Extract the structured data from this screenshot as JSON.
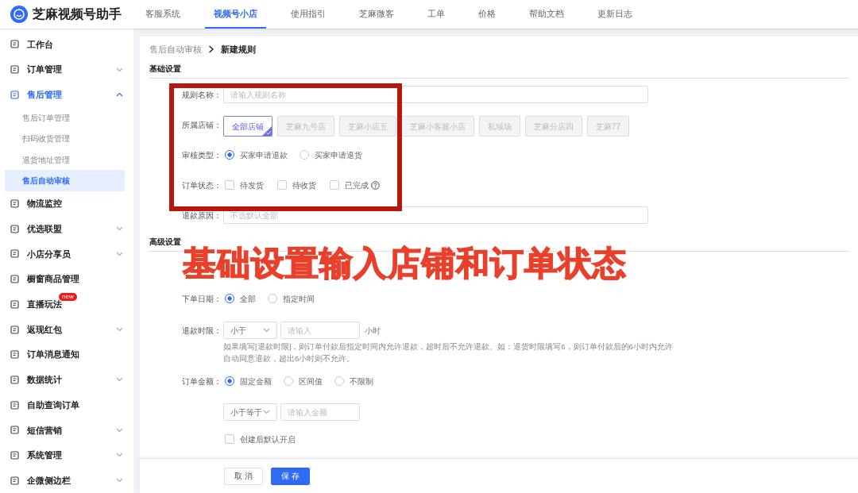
{
  "app": {
    "title": "芝麻视频号助手"
  },
  "top_nav": [
    {
      "label": "客服系统",
      "selected": false
    },
    {
      "label": "视频号小店",
      "selected": true
    },
    {
      "label": "使用指引",
      "selected": false
    },
    {
      "label": "芝麻微客",
      "selected": false
    },
    {
      "label": "工单",
      "selected": false
    },
    {
      "label": "价格",
      "selected": false
    },
    {
      "label": "帮助文档",
      "selected": false
    },
    {
      "label": "更新日志",
      "selected": false
    }
  ],
  "sidebar": {
    "items": [
      {
        "label": "工作台",
        "selected": false
      },
      {
        "label": "订单管理",
        "selected": false,
        "expanded": false
      },
      {
        "label": "售后管理",
        "selected": true,
        "expanded": true,
        "children": [
          {
            "label": "售后订单管理",
            "selected": false
          },
          {
            "label": "扫码收货管理",
            "selected": false
          },
          {
            "label": "退货地址管理",
            "selected": false
          },
          {
            "label": "售后自动审核",
            "selected": true
          }
        ]
      },
      {
        "label": "物流监控",
        "selected": false
      },
      {
        "label": "优选联盟",
        "selected": false,
        "expanded": false
      },
      {
        "label": "小店分享员",
        "selected": false,
        "expanded": false
      },
      {
        "label": "橱窗商品管理",
        "selected": false
      },
      {
        "label": "直播玩法",
        "selected": false,
        "badge": "new"
      },
      {
        "label": "返现红包",
        "selected": false,
        "expanded": false
      },
      {
        "label": "订单消息通知",
        "selected": false
      },
      {
        "label": "数据统计",
        "selected": false,
        "expanded": false
      },
      {
        "label": "自助查询订单",
        "selected": false
      },
      {
        "label": "短信营销",
        "selected": false,
        "expanded": false
      },
      {
        "label": "系统管理",
        "selected": false,
        "expanded": false
      },
      {
        "label": "企微侧边栏",
        "selected": false,
        "expanded": false
      }
    ]
  },
  "breadcrumb": [
    {
      "label": "售后自动审核"
    },
    {
      "label": "新建规则"
    }
  ],
  "basic_settings": {
    "title": "基础设置",
    "fields": [
      {
        "kind": "input",
        "label": "规则名称：",
        "placeholder": "请输入规则名称"
      },
      {
        "kind": "shops",
        "label": "所属店铺：",
        "options": [
          {
            "label": "全部店铺",
            "selected": true
          },
          {
            "label": "芝麻九号店",
            "selected": false
          },
          {
            "label": "芝麻小店五",
            "selected": false
          },
          {
            "label": "芝麻小客服小店",
            "selected": false
          },
          {
            "label": "私域场",
            "selected": false
          },
          {
            "label": "芝麻分店四",
            "selected": false
          },
          {
            "label": "芝麻77",
            "selected": false
          }
        ]
      },
      {
        "kind": "radio",
        "label": "审核类型：",
        "options": [
          {
            "label": "买家申请退款",
            "selected": true
          },
          {
            "label": "买家申请退货",
            "selected": false
          }
        ]
      },
      {
        "kind": "checkbox",
        "label": "订单状态：",
        "options": [
          {
            "label": "待发货",
            "checked": false
          },
          {
            "label": "待收货",
            "checked": false
          },
          {
            "label": "已完成",
            "checked": false,
            "help": true
          }
        ]
      },
      {
        "kind": "input",
        "label": "退款原因：",
        "placeholder": "不选默认全部"
      }
    ]
  },
  "advanced_settings": {
    "title": "高级设置",
    "fields": [
      {
        "kind": "radio",
        "label": "下单日期：",
        "options": [
          {
            "label": "全部",
            "selected": true
          },
          {
            "label": "指定时间",
            "selected": false
          }
        ]
      },
      {
        "kind": "limit",
        "label": "退款时限：",
        "select": "小于",
        "placeholder": "请输入",
        "unit": "小时",
        "hint": "如果填写[退款时限]，则订单付款后指定时间内允许退款，超时后不允许退款。如：退货时限填写6，则订单付款后的6小时内允许自动同意退款，超出6小时则不允许。"
      },
      {
        "kind": "radio",
        "label": "订单金额：",
        "options": [
          {
            "label": "固定金额",
            "selected": true
          },
          {
            "label": "区间值",
            "selected": false
          },
          {
            "label": "不限制",
            "selected": false
          }
        ]
      },
      {
        "kind": "limit",
        "select": "小于等于",
        "placeholder": "请输入金额"
      },
      {
        "kind": "checkbox",
        "options": [
          {
            "label": "创建后默认开启",
            "checked": false
          }
        ]
      }
    ]
  },
  "footer_buttons": [
    {
      "label": "取 消",
      "kind": "secondary"
    },
    {
      "label": "保 存",
      "kind": "primary"
    }
  ],
  "annotation": {
    "text": "基础设置输入店铺和订单状态"
  }
}
